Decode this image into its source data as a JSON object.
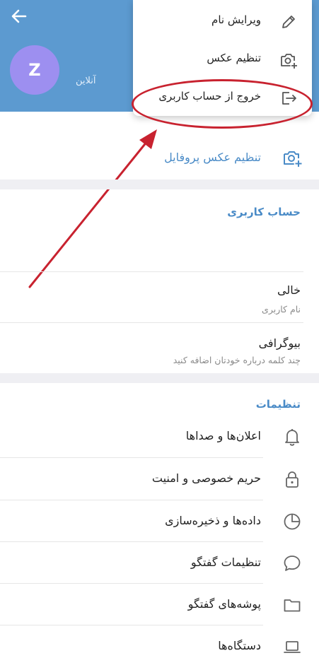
{
  "header": {
    "avatar_letter": "Z",
    "status": "آنلاین",
    "background_color": "#5c9ad0",
    "avatar_color": "#9d8ff0"
  },
  "menu": {
    "items": [
      {
        "label": "ویرایش نام",
        "icon": "pencil-icon"
      },
      {
        "label": "تنظیم عکس",
        "icon": "camera-add-icon"
      },
      {
        "label": "خروج از حساب کاربری",
        "icon": "logout-icon"
      }
    ]
  },
  "annotation": {
    "color": "#c8222f"
  },
  "profile": {
    "set_photo_label": "تنظیم عکس پروفایل",
    "accent_color": "#4a8bc7"
  },
  "account": {
    "title": "حساب کاربری",
    "username_value": "خالی",
    "username_hint": "نام کاربری",
    "bio_value": "بیوگرافی",
    "bio_hint": "چند کلمه درباره خودتان اضافه کنید"
  },
  "settings": {
    "title": "تنظیمات",
    "items": [
      {
        "label": "اعلان‌ها و صداها",
        "icon": "bell-icon"
      },
      {
        "label": "حریم خصوصی و امنیت",
        "icon": "lock-icon"
      },
      {
        "label": "داده‌ها و ذخیره‌سازی",
        "icon": "pie-chart-icon"
      },
      {
        "label": "تنظیمات گفتگو",
        "icon": "chat-bubble-icon"
      },
      {
        "label": "پوشه‌های گفتگو",
        "icon": "folder-icon"
      },
      {
        "label": "دستگاه‌ها",
        "icon": "laptop-icon"
      }
    ]
  }
}
